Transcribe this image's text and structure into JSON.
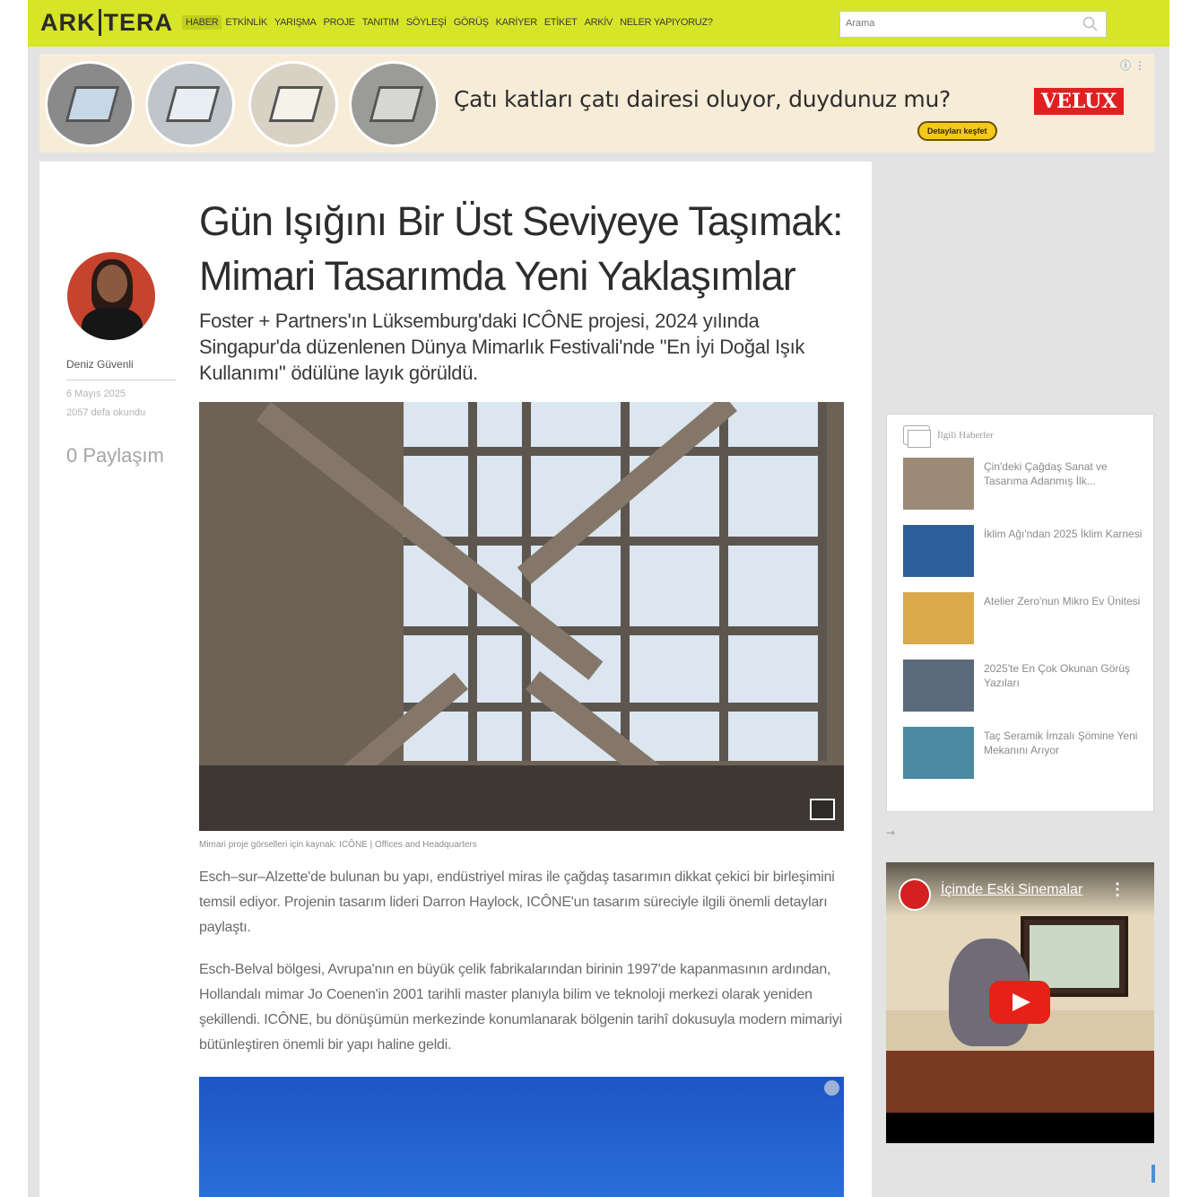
{
  "nav": {
    "logo_left": "ARK",
    "logo_right": "TERA",
    "links": [
      "HABER",
      "ETKİNLİK",
      "YARIŞMA",
      "PROJE",
      "TANITIM",
      "SÖYLEŞİ",
      "GÖRÜŞ",
      "KARİYER",
      "ETİKET",
      "ARKİV",
      "NELER YAPIYORUZ?"
    ],
    "active": "HABER",
    "search_placeholder": "Arama",
    "accent_color": "#d7e528"
  },
  "ad": {
    "headline": "Çatı katları çatı dairesi oluyor, duydunuz mu?",
    "brand": "VELUX",
    "button": "Detayları keşfet"
  },
  "article": {
    "title": "Gün Işığını Bir Üst Seviyeye Taşımak: Mimari Tasarımda Yeni Yaklaşımlar",
    "subtitle": "Foster + Partners'ın Lüksemburg'daki ICÔNE projesi, 2024 yılında Singapur'da düzenlenen Dünya Mimarlık Festivali'nde \"En İyi Doğal Işık Kullanımı\" ödülüne layık görüldü.",
    "author": "Deniz Güvenli",
    "date": "6 Mayıs 2025",
    "reads": "2057 defa okundu",
    "shares": "0 Paylaşım",
    "caption": "Mimari proje görselleri için kaynak: ICÔNE | Offices and Headquarters",
    "paragraphs": [
      "Esch–sur–Alzette'de bulunan bu yapı, endüstriyel miras ile çağdaş tasarımın dikkat çekici bir birleşimini temsil ediyor. Projenin tasarım lideri Darron Haylock, ICÔNE'un tasarım süreciyle ilgili önemli detayları paylaştı.",
      "Esch-Belval bölgesi, Avrupa'nın en büyük çelik fabrikalarından birinin 1997'de kapanmasının ardından, Hollandalı mimar Jo Coenen'in 2001 tarihli master planıyla bilim ve teknoloji merkezi olarak yeniden şekillendi. ICÔNE, bu dönüşümün merkezinde konumlanarak bölgenin tarihî dokusuyla modern mimariyi bütünleştiren önemli bir yapı haline geldi."
    ]
  },
  "sidebar": {
    "heading": "İlgili Haberler",
    "items": [
      {
        "title": "Çin'deki Çağdaş Sanat ve Tasarıma Adanmış İlk...",
        "color": "#9a8a76"
      },
      {
        "title": "İklim Ağı'ndan 2025 İklim Karnesi",
        "color": "#2f5f9a"
      },
      {
        "title": "Atelier Zero'nun Mikro Ev Ünitesi",
        "color": "#d9a94a"
      },
      {
        "title": "2025'te En Çok Okunan Görüş Yazıları",
        "color": "#5a6a7a"
      },
      {
        "title": "Taç Seramik İmzalı Şömine Yeni Mekanını Arıyor",
        "color": "#4a8aa0"
      }
    ],
    "arrow": "→",
    "video_title": "İçimde Eski Sinemalar"
  }
}
